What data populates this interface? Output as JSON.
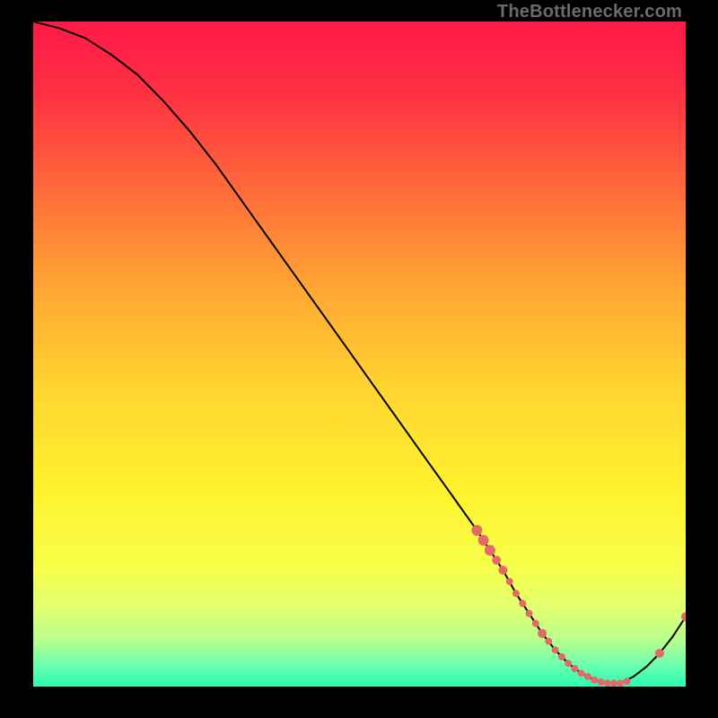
{
  "watermark": "TheBottlenecker.com",
  "chart_data": {
    "type": "line",
    "title": "",
    "xlabel": "",
    "ylabel": "",
    "xlim": [
      0,
      100
    ],
    "ylim": [
      0,
      100
    ],
    "grid": false,
    "legend": false,
    "x": [
      0,
      4,
      8,
      12,
      16,
      20,
      24,
      28,
      32,
      36,
      40,
      44,
      48,
      52,
      56,
      60,
      64,
      68,
      70,
      72,
      74,
      76,
      78,
      80,
      82,
      84,
      86,
      88,
      90,
      92,
      94,
      96,
      98,
      100
    ],
    "values": [
      100,
      99,
      97.5,
      95,
      92,
      88,
      83.5,
      78.5,
      73,
      67.5,
      62,
      56.5,
      51,
      45.5,
      40,
      34.5,
      29,
      23.5,
      20.5,
      17.5,
      14,
      11,
      8,
      5.5,
      3.5,
      2,
      1,
      0.5,
      0.5,
      1.5,
      3,
      5,
      7.5,
      10.5
    ],
    "markers": {
      "x": [
        68,
        69,
        70,
        71,
        72,
        73,
        74,
        75,
        76,
        77,
        78,
        79,
        80,
        81,
        82,
        83,
        84,
        85,
        86,
        87,
        88,
        89,
        90,
        91,
        96,
        100
      ],
      "y": [
        23.5,
        22,
        20.5,
        19,
        17.5,
        15.8,
        14,
        12.5,
        11,
        9.5,
        8,
        6.8,
        5.5,
        4.5,
        3.5,
        2.7,
        2,
        1.5,
        1,
        0.7,
        0.5,
        0.5,
        0.5,
        0.8,
        5,
        10.5
      ],
      "color": "#e36a6a",
      "size_sequence": [
        6,
        6,
        6,
        5,
        5,
        4,
        4,
        4,
        4,
        4,
        5,
        4,
        4,
        4,
        4,
        4,
        4,
        4,
        4,
        4,
        4,
        4,
        4,
        4,
        5,
        5
      ]
    },
    "line": {
      "color": "#000000",
      "width": 2
    },
    "background_gradient": {
      "stops": [
        {
          "pos": 0.0,
          "color": "#ff1a48"
        },
        {
          "pos": 0.1,
          "color": "#ff2e45"
        },
        {
          "pos": 0.25,
          "color": "#ff6a3a"
        },
        {
          "pos": 0.4,
          "color": "#ffa634"
        },
        {
          "pos": 0.55,
          "color": "#ffd430"
        },
        {
          "pos": 0.7,
          "color": "#fff12e"
        },
        {
          "pos": 0.82,
          "color": "#f7ff4a"
        },
        {
          "pos": 0.88,
          "color": "#e3ff70"
        },
        {
          "pos": 0.93,
          "color": "#b8ff8c"
        },
        {
          "pos": 0.97,
          "color": "#66ffb0"
        },
        {
          "pos": 1.0,
          "color": "#2bfdb1"
        }
      ]
    }
  }
}
